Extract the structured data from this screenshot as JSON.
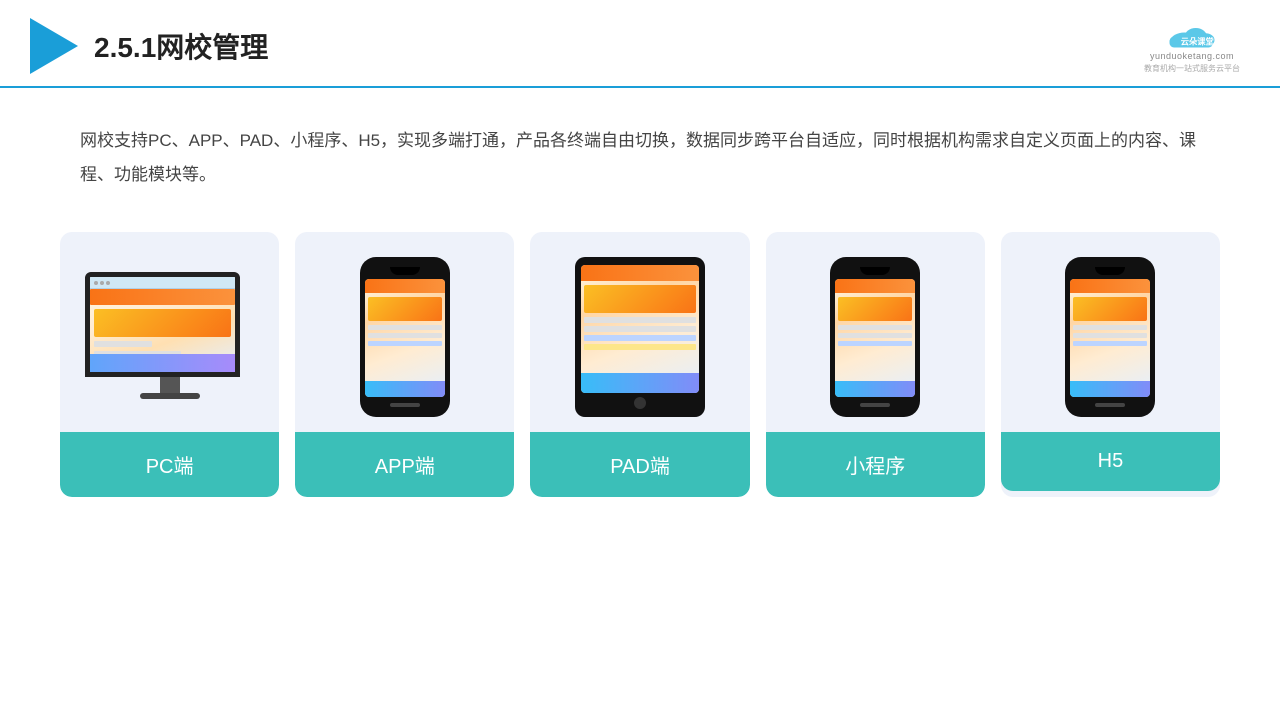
{
  "header": {
    "title": "2.5.1网校管理",
    "brand_name": "云朵课堂",
    "brand_url": "yunduoketang.com",
    "brand_tagline": "教育机构一站式服务云平台"
  },
  "description": {
    "text": "网校支持PC、APP、PAD、小程序、H5，实现多端打通，产品各终端自由切换，数据同步跨平台自适应，同时根据机构需求自定义页面上的内容、课程、功能模块等。"
  },
  "cards": [
    {
      "id": "pc",
      "label": "PC端",
      "device": "pc"
    },
    {
      "id": "app",
      "label": "APP端",
      "device": "phone"
    },
    {
      "id": "pad",
      "label": "PAD端",
      "device": "tablet"
    },
    {
      "id": "miniapp",
      "label": "小程序",
      "device": "phone"
    },
    {
      "id": "h5",
      "label": "H5",
      "device": "phone"
    }
  ],
  "colors": {
    "accent": "#1a9ed8",
    "card_bg": "#eef2fa",
    "card_label_bg": "#3bbfb8",
    "card_label_text": "#ffffff"
  }
}
